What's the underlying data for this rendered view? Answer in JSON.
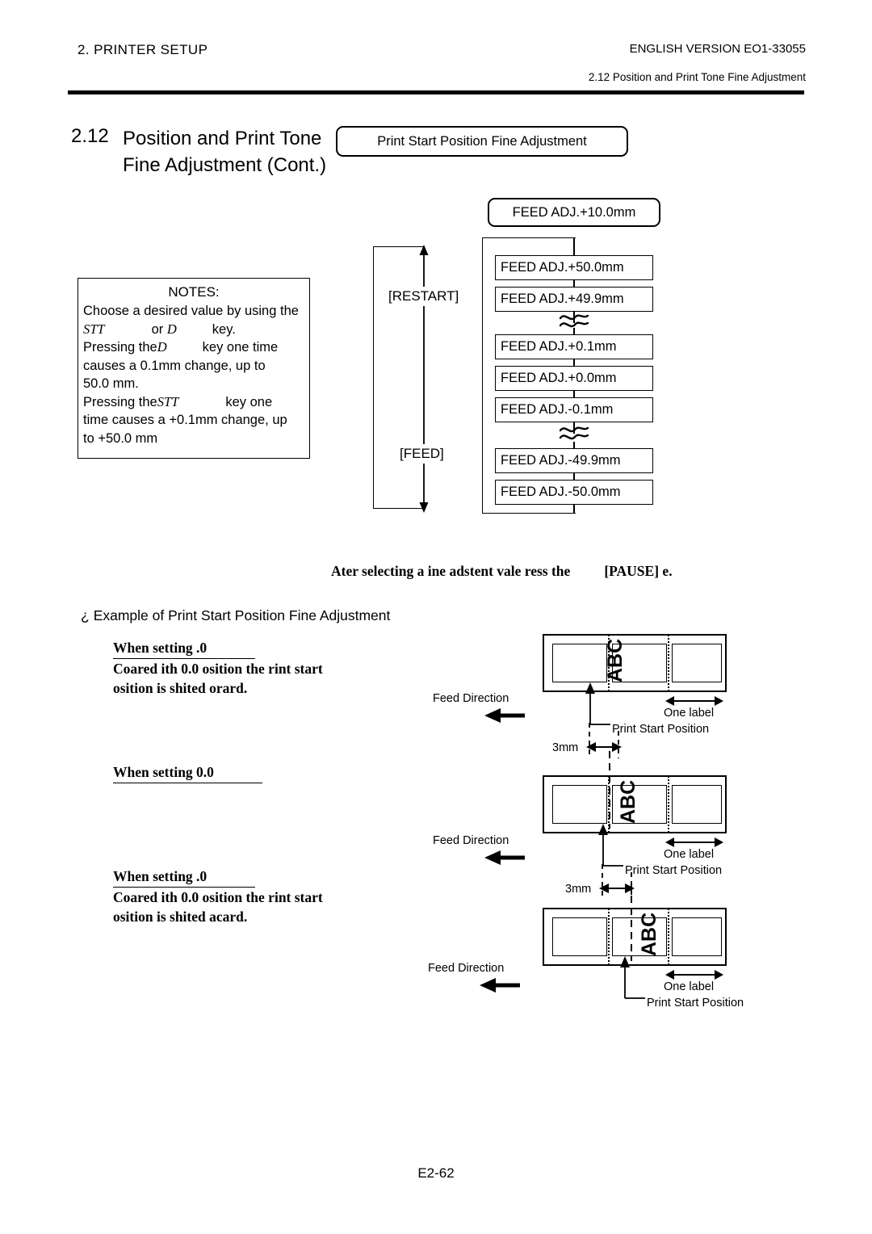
{
  "header": {
    "chapter": "2. PRINTER SETUP",
    "version": "ENGLISH VERSION EO1-33055",
    "section_ref": "2.12 Position and Print Tone Fine Adjustment"
  },
  "section": {
    "number": "2.12",
    "title": "Position and Print Tone Fine Adjustment (Cont.)"
  },
  "headline_box": "Print Start Position Fine Adjustment",
  "notes": {
    "title": "NOTES:",
    "line1": "Choose a desired value by using the",
    "key_restart": "STT",
    "or": "or",
    "key_feed": "D",
    "key_word": "key.",
    "line2_a": "Pressing the",
    "line2_key": "D",
    "line2_b": "key one time",
    "line3": "causes a  0.1mm change, up to",
    "line4": " 50.0 mm.",
    "line5_a": "Pressing the",
    "line5_key": "STT",
    "line5_b": "key one",
    "line6": "time causes a +0.1mm change, up",
    "line7": "to +50.0 mm"
  },
  "flow": {
    "top_state": "FEED ADJ.+10.0mm",
    "loop_label_up": "[RESTART]",
    "loop_label_down": "[FEED]",
    "states": [
      "FEED ADJ.+50.0mm",
      "FEED ADJ.+49.9mm",
      "FEED ADJ.+0.1mm",
      "FEED ADJ.+0.0mm",
      "FEED ADJ.-0.1mm",
      "FEED ADJ.-49.9mm",
      "FEED ADJ.-50.0mm"
    ]
  },
  "instruction": {
    "text": "Ater selecting a ine adstent vale ress the",
    "key": "[PAUSE]",
    "tail": "e."
  },
  "example": {
    "bullet": "¿",
    "heading": "Example of Print Start Position Fine Adjustment"
  },
  "cases": [
    {
      "title": "When setting .0",
      "desc_line1": "Coared ith 0.0 osition the rint start",
      "desc_line2": "osition is shited orard."
    },
    {
      "title": "When setting 0.0",
      "desc_line1": "",
      "desc_line2": ""
    },
    {
      "title": "When setting .0",
      "desc_line1": "Coared ith 0.0 osition the rint start",
      "desc_line2": "osition is shited acard."
    }
  ],
  "diagrams": [
    {
      "abc": "ABC",
      "feed_direction": "Feed Direction",
      "one_label": "One label",
      "print_start_position": "Print Start Position",
      "dimension": "3mm"
    },
    {
      "abc": "ABC",
      "feed_direction": "Feed Direction",
      "one_label": "One label",
      "print_start_position": "Print Start Position",
      "dimension": "3mm"
    },
    {
      "abc": "ABC",
      "feed_direction": "Feed Direction",
      "one_label": "One label",
      "print_start_position": "Print Start Position",
      "dimension": ""
    }
  ],
  "footer": "E2-62"
}
